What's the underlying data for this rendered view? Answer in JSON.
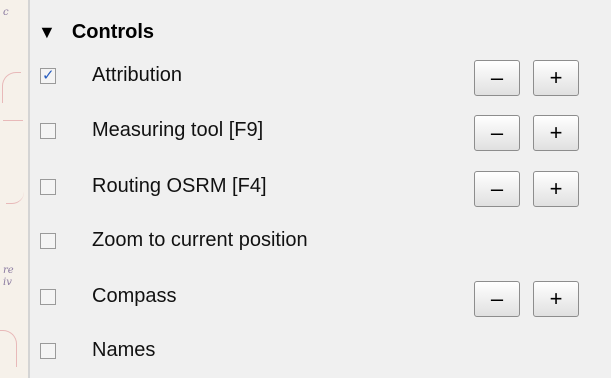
{
  "map": {
    "fragment_top": "c",
    "fragment_mid1": "re",
    "fragment_mid2": "iv"
  },
  "controls": {
    "title": "Controls",
    "expander_glyph": "▼",
    "minus_label": "–",
    "plus_label": "+",
    "items": [
      {
        "label": "Attribution",
        "checked": true,
        "has_zoom_buttons": true
      },
      {
        "label": "Measuring tool [F9]",
        "checked": false,
        "has_zoom_buttons": true
      },
      {
        "label": "Routing OSRM [F4]",
        "checked": false,
        "has_zoom_buttons": true
      },
      {
        "label": "Zoom to current position",
        "checked": false,
        "has_zoom_buttons": false
      },
      {
        "label": "Compass",
        "checked": false,
        "has_zoom_buttons": true
      },
      {
        "label": "Names",
        "checked": false,
        "has_zoom_buttons": false
      }
    ]
  },
  "colors": {
    "panel_bg": "#f0f0f0",
    "check_color": "#2a5fc0"
  }
}
